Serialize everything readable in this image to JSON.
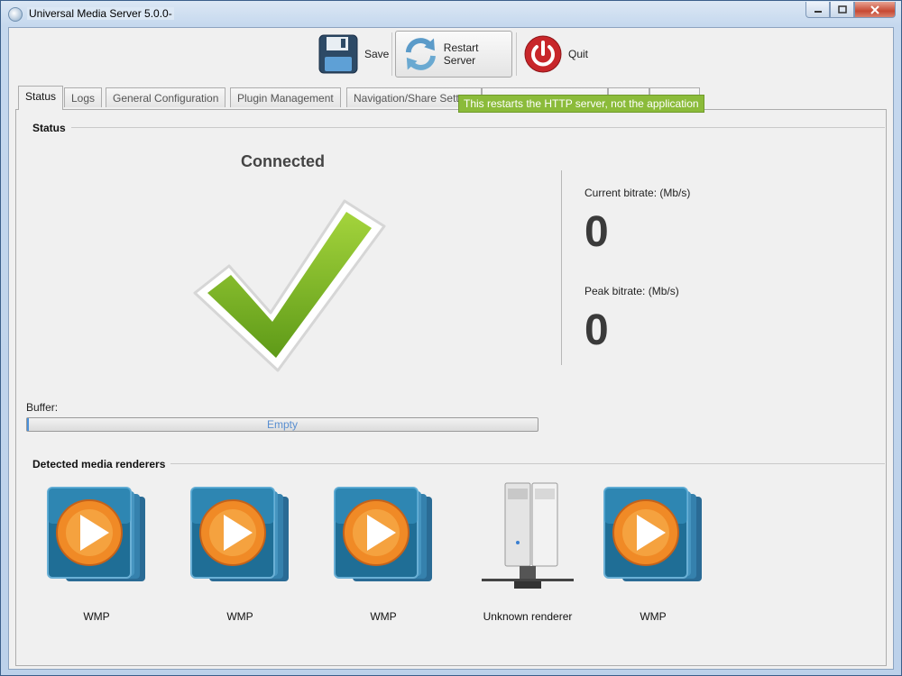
{
  "window": {
    "title": "Universal Media Server 5.0.0-"
  },
  "toolbar": {
    "save_label": "Save",
    "restart_label": "Restart Server",
    "quit_label": "Quit"
  },
  "tooltip": {
    "text": "This restarts the HTTP server, not the application"
  },
  "tabs": [
    {
      "label": "Status"
    },
    {
      "label": "Logs"
    },
    {
      "label": "General Configuration"
    },
    {
      "label": "Plugin Management"
    },
    {
      "label": "Navigation/Share Sett"
    }
  ],
  "status": {
    "section_title": "Status",
    "connection": "Connected",
    "current_bitrate_label": "Current bitrate: (Mb/s)",
    "current_bitrate_value": "0",
    "peak_bitrate_label": "Peak bitrate: (Mb/s)",
    "peak_bitrate_value": "0",
    "buffer_label": "Buffer:",
    "buffer_text": "Empty",
    "buffer_fill_fraction": 0.003
  },
  "renderers": {
    "section_title": "Detected media renderers",
    "items": [
      {
        "name": "WMP",
        "icon": "wmp-icon"
      },
      {
        "name": "WMP",
        "icon": "wmp-icon"
      },
      {
        "name": "WMP",
        "icon": "wmp-icon"
      },
      {
        "name": "Unknown renderer",
        "icon": "server-tower-icon"
      },
      {
        "name": "WMP",
        "icon": "wmp-icon"
      }
    ]
  },
  "colors": {
    "tooltip_bg": "#8bbb3a",
    "check_green": "#7dbb1f",
    "quit_red": "#c8262a",
    "progress_text": "#5a8fd0"
  }
}
